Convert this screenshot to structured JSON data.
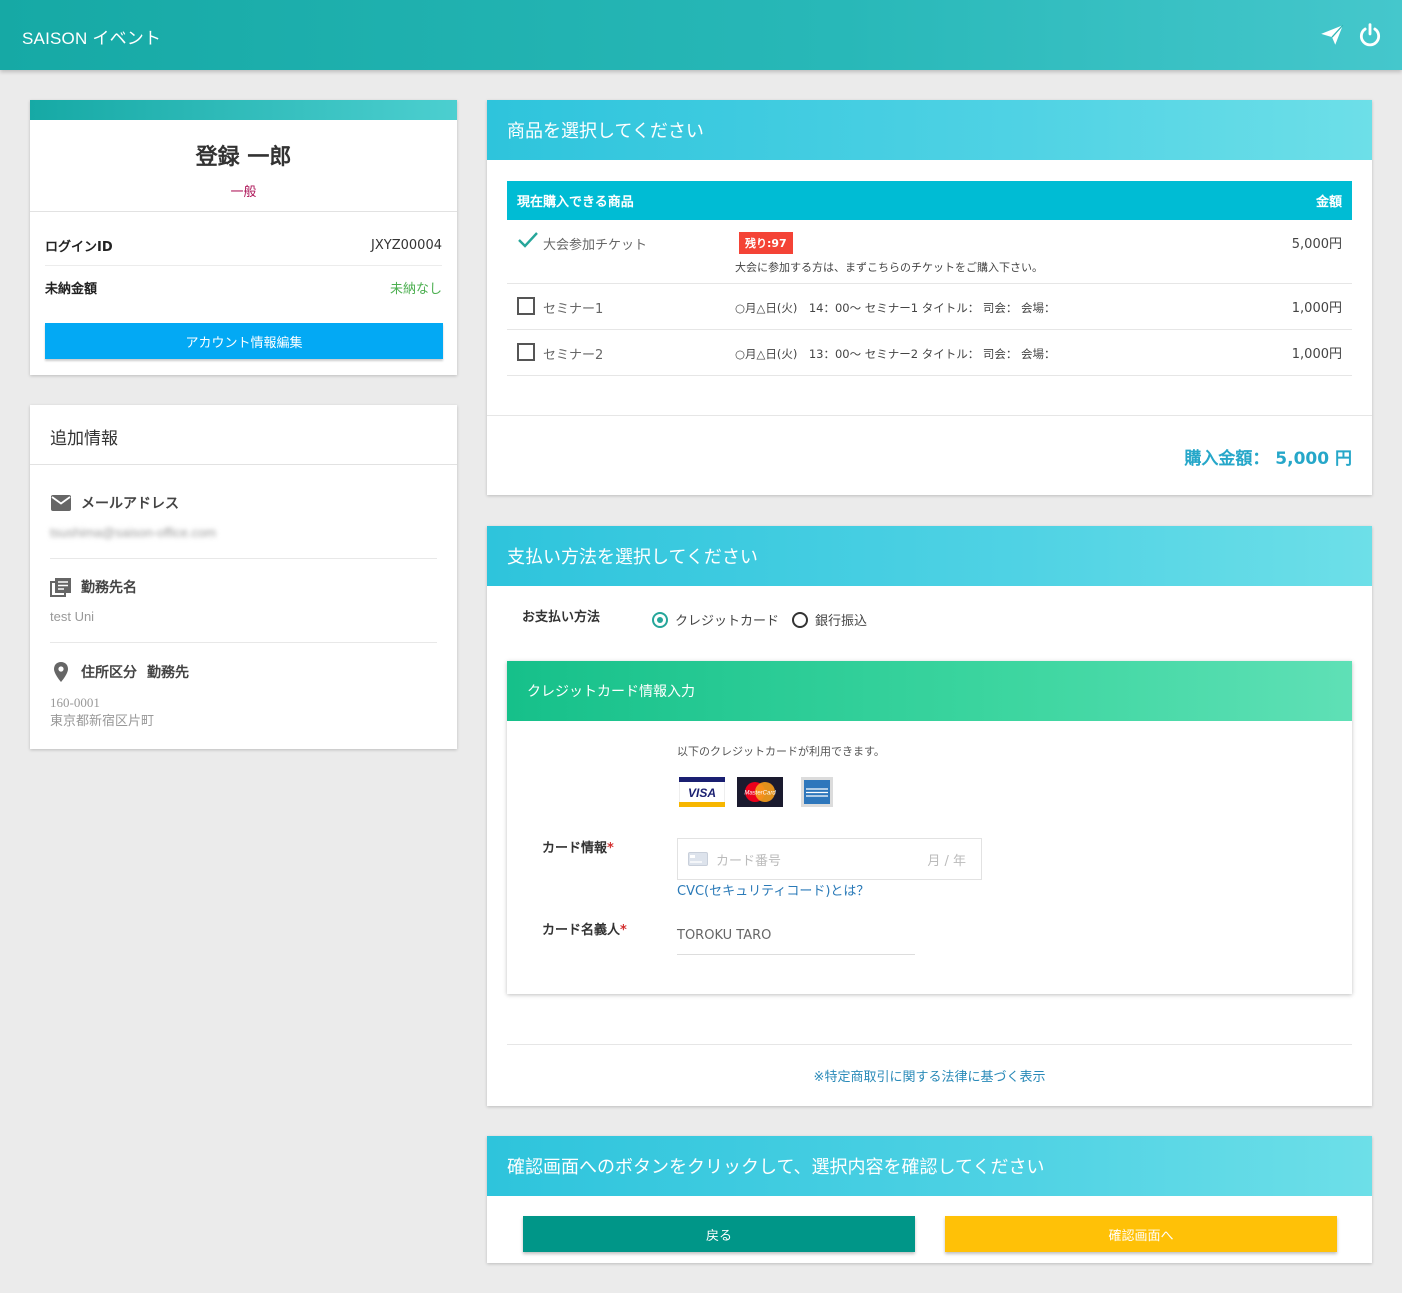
{
  "app": {
    "title": "SAISON イベント",
    "icons": [
      "send-icon",
      "power-icon"
    ]
  },
  "profile": {
    "name": "登録 一郎",
    "role": "一般",
    "login_id_label": "ログインID",
    "login_id": "JXYZ00004",
    "unpaid_label": "未納金額",
    "unpaid_value": "未納なし",
    "edit_button": "アカウント情報編集"
  },
  "extra": {
    "title": "追加情報",
    "email_label": "メールアドレス",
    "email_value": "tsushima@saison-office.com",
    "work_label": "勤務先名",
    "work_value": "test Uni",
    "address_label": "住所区分",
    "address_type": "勤務先",
    "postal": "160-0001",
    "address": "東京都新宿区片町"
  },
  "products": {
    "title": "商品を選択してください",
    "col_item": "現在購入できる商品",
    "col_price": "金額",
    "rows": [
      {
        "name": "大会参加チケット",
        "badge": "残り:97",
        "desc": "大会に参加する方は、まずこちらのチケットをご購入下さい。",
        "price": "5,000円",
        "checked": true
      },
      {
        "name": "セミナー1",
        "desc": "○月△日(火)　14：00～ セミナー1 タイトル：  司会：  会場：",
        "price": "1,000円",
        "checked": false
      },
      {
        "name": "セミナー2",
        "desc": "○月△日(火)　13：00～ セミナー2 タイトル：  司会：  会場：",
        "price": "1,000円",
        "checked": false
      }
    ],
    "total_label": "購入金額：",
    "total_value": "5,000 円"
  },
  "payment": {
    "title": "支払い方法を選択してください",
    "method_label": "お支払い方法",
    "options": [
      "クレジットカード",
      "銀行振込"
    ],
    "selected": "クレジットカード",
    "cc_title": "クレジットカード情報入力",
    "cc_note": "以下のクレジットカードが利用できます。",
    "card_brands": [
      "VISA",
      "MasterCard",
      "AMERICAN EXPRESS"
    ],
    "card_info_label": "カード情報",
    "card_number_placeholder": "カード番号",
    "card_expiry_placeholder": "月 / 年",
    "cvc_link": "CVC(セキュリティコード)とは？",
    "card_name_label": "カード名義人",
    "card_name_value": "TOROKU TARO",
    "law_link": "※特定商取引に関する法律に基づく表示"
  },
  "confirm": {
    "title": "確認画面へのボタンをクリックして、選択内容を確認してください",
    "back_button": "戻る",
    "next_button": "確認画面へ"
  },
  "colors": {
    "topbar": "#16a9a5",
    "section_header": "#2ec4dc",
    "table_header": "#00bcd4",
    "cc_header": "#16c08a",
    "account_button": "#03a9f4",
    "back_button": "#009688",
    "next_button": "#ffc107",
    "badge": "#f44336"
  }
}
